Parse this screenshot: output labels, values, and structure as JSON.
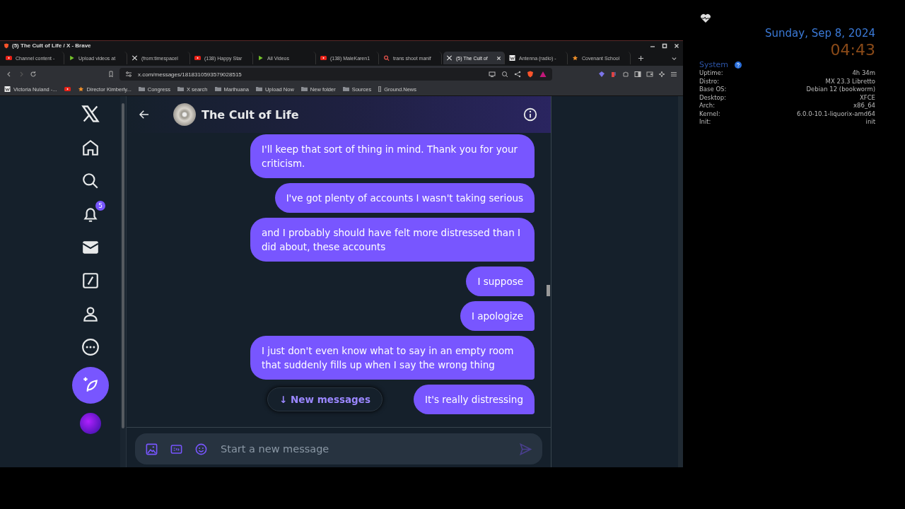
{
  "browser": {
    "title": "(5) The Cult of Life / X - Brave",
    "tabs": [
      {
        "label": "Channel content -",
        "kind": "youtube",
        "selected": false
      },
      {
        "label": "Upload videos at",
        "kind": "rumble",
        "selected": false
      },
      {
        "label": "(from:timespacel",
        "kind": "x",
        "selected": false
      },
      {
        "label": "(138) Happy Star",
        "kind": "youtube",
        "selected": false
      },
      {
        "label": "All Videos",
        "kind": "rumble",
        "selected": false
      },
      {
        "label": "(138) MaleKaren1",
        "kind": "youtube",
        "selected": false
      },
      {
        "label": "trans shoot manif",
        "kind": "search",
        "selected": false
      },
      {
        "label": "(5) The Cult of",
        "kind": "x",
        "selected": true
      },
      {
        "label": "Antenna (radio) -",
        "kind": "wiki",
        "selected": false
      },
      {
        "label": "Covenant School",
        "kind": "star",
        "selected": false
      }
    ],
    "address": "x.com/messages/1818310593579028515",
    "bookmarks": [
      {
        "label": "Victoria Nuland -...",
        "kind": "wiki"
      },
      {
        "kind": "youtube"
      },
      {
        "label": "Director Kimberly...",
        "kind": "star"
      },
      {
        "label": "Congress",
        "kind": "folder"
      },
      {
        "label": "X search",
        "kind": "folder"
      },
      {
        "label": "Marihuana",
        "kind": "folder"
      },
      {
        "label": "Upload Now",
        "kind": "folder"
      },
      {
        "label": "New folder",
        "kind": "folder"
      },
      {
        "label": "Sources",
        "kind": "folder"
      },
      {
        "label": "Ground.News",
        "kind": "bar"
      }
    ]
  },
  "sidebar": {
    "notification_count": "5"
  },
  "conversation": {
    "name": "The Cult of Life",
    "messages": [
      "I'll keep that sort of thing in mind. Thank you for your criticism.",
      "I've got plenty of accounts I wasn't taking serious",
      "and I probably should have felt more distressed than I did about, these accounts",
      "I suppose",
      "I apologize",
      "I just don't even know what to say in an empty room that suddenly fills up when I say the wrong thing",
      "It's really distressing"
    ],
    "new_messages_label": "↓ New messages",
    "composer": {
      "placeholder": "Start a new message"
    }
  },
  "desktop": {
    "date": "Sunday, Sep 8, 2024",
    "time": "04:43",
    "system": {
      "title": "System",
      "rows": [
        {
          "label": "Uptime:",
          "value": "4h 34m"
        },
        {
          "label": "Distro:",
          "value": "MX 23.3 Libretto"
        },
        {
          "label": "Base OS:",
          "value": "Debian 12 (bookworm)"
        },
        {
          "label": "Desktop:",
          "value": "XFCE"
        },
        {
          "label": "Arch:",
          "value": "x86_64"
        },
        {
          "label": "Kernel:",
          "value": "6.0.0-10.1-liquorix-amd64"
        },
        {
          "label": "Init:",
          "value": "init"
        }
      ]
    }
  }
}
